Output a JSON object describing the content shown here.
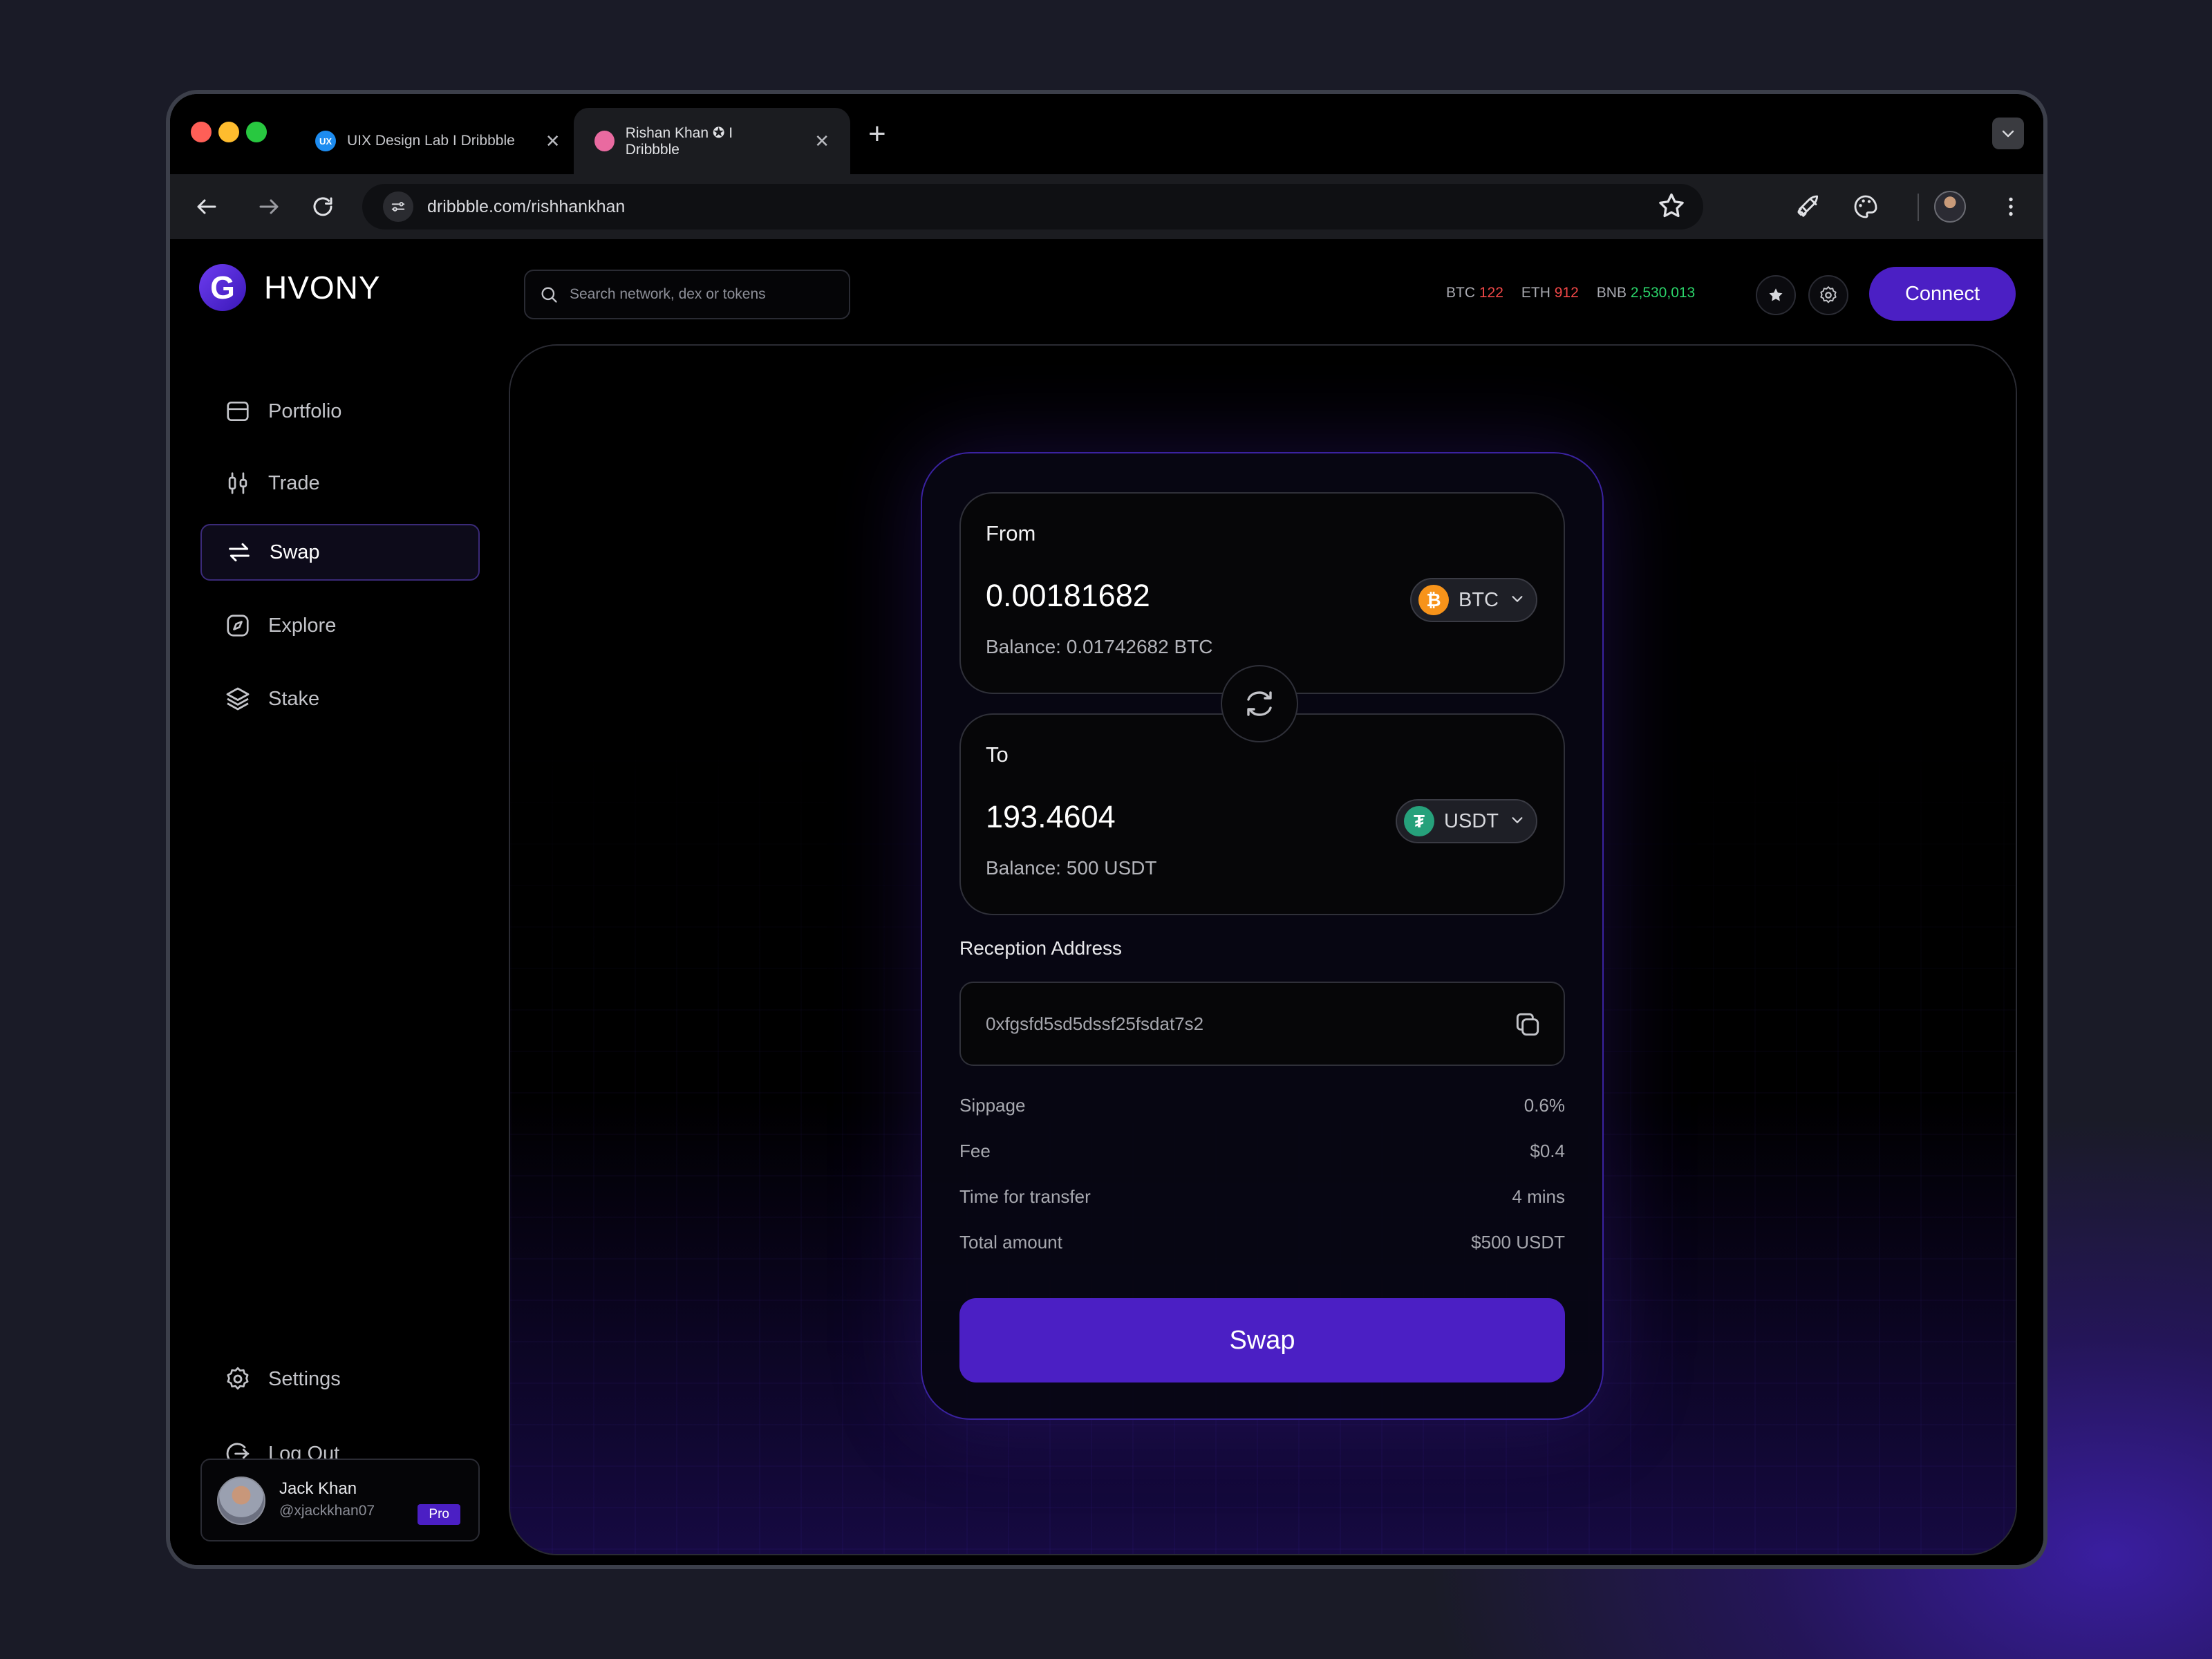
{
  "browser": {
    "tabs": [
      {
        "label": "UIX Design Lab  I  Dribbble",
        "favicon": "uix-favicon"
      },
      {
        "label": "Rishan Khan ✪  I  Dribbble",
        "favicon": "dribbble-favicon"
      }
    ],
    "url": "dribbble.com/rishhankhan"
  },
  "app": {
    "brand": "HVONY",
    "brand_letter": "G",
    "search_placeholder": "Search network, dex or tokens",
    "tickers": [
      {
        "symbol": "BTC",
        "value": "122",
        "color": "#f04747"
      },
      {
        "symbol": "ETH",
        "value": "912",
        "color": "#f04747"
      },
      {
        "symbol": "BNB",
        "value": "2,530,013",
        "color": "#2bd46a"
      }
    ],
    "connect_label": "Connect"
  },
  "sidebar": {
    "items": [
      {
        "label": "Portfolio",
        "icon": "wallet-icon"
      },
      {
        "label": "Trade",
        "icon": "candlestick-icon"
      },
      {
        "label": "Swap",
        "icon": "swap-icon",
        "active": true
      },
      {
        "label": "Explore",
        "icon": "compass-icon"
      },
      {
        "label": "Stake",
        "icon": "layers-icon"
      }
    ],
    "settings_label": "Settings",
    "logout_label": "Log Out",
    "user": {
      "name": "Jack Khan",
      "handle": "@xjackkhan07",
      "badge": "Pro"
    }
  },
  "swap": {
    "from": {
      "label": "From",
      "amount": "0.00181682",
      "token": "BTC",
      "balance": "Balance: 0.01742682 BTC"
    },
    "to": {
      "label": "To",
      "amount": "193.4604",
      "token": "USDT",
      "balance": "Balance: 500 USDT"
    },
    "reception_label": "Reception Address",
    "reception_address": "0xfgsfd5sd5dssf25fsdat7s2",
    "details": [
      {
        "label": "Sippage",
        "value": "0.6%"
      },
      {
        "label": "Fee",
        "value": "$0.4"
      },
      {
        "label": "Time for transfer",
        "value": "4 mins"
      },
      {
        "label": "Total amount",
        "value": "$500 USDT"
      }
    ],
    "swap_button": "Swap"
  },
  "colors": {
    "accent": "#4b1fc4",
    "btc": "#f7931a",
    "usdt": "#26a17b"
  }
}
